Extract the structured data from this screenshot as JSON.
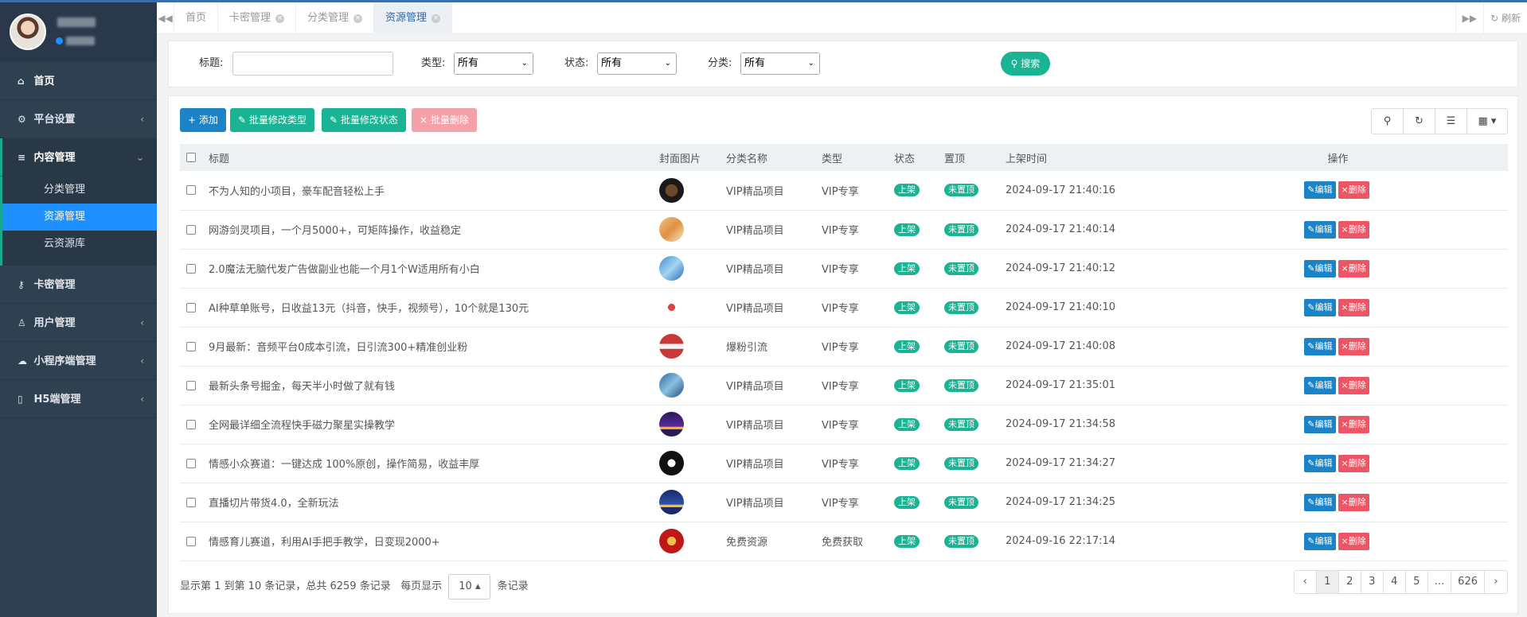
{
  "sidebar": {
    "items": [
      {
        "label": "首页",
        "icon": "home-icon"
      },
      {
        "label": "平台设置",
        "icon": "gear-icon"
      },
      {
        "label": "内容管理",
        "icon": "database-icon"
      },
      {
        "label": "卡密管理",
        "icon": "key-icon"
      },
      {
        "label": "用户管理",
        "icon": "user-icon"
      },
      {
        "label": "小程序端管理",
        "icon": "wechat-icon"
      },
      {
        "label": "H5端管理",
        "icon": "mobile-icon"
      }
    ],
    "sub_items": [
      "分类管理",
      "资源管理",
      "云资源库"
    ]
  },
  "tabs": {
    "items": [
      "首页",
      "卡密管理",
      "分类管理",
      "资源管理"
    ],
    "refresh_label": "刷新"
  },
  "search": {
    "title_label": "标题:",
    "type_label": "类型:",
    "type_value": "所有",
    "status_label": "状态:",
    "status_value": "所有",
    "category_label": "分类:",
    "category_value": "所有",
    "button_label": "搜索"
  },
  "toolbar": {
    "add_label": "添加",
    "batch_type_label": "批量修改类型",
    "batch_status_label": "批量修改状态",
    "batch_delete_label": "批量删除"
  },
  "table": {
    "headers": [
      "标题",
      "封面图片",
      "分类名称",
      "类型",
      "状态",
      "置顶",
      "上架时间",
      "操作"
    ],
    "edit_label": "编辑",
    "delete_label": "删除",
    "rows": [
      {
        "title": "不为人知的小项目，豪车配音轻松上手",
        "category": "VIP精品项目",
        "type": "VIP专享",
        "status": "上架",
        "top": "未置顶",
        "time": "2024-09-17 21:40:16"
      },
      {
        "title": "网游剑灵项目，一个月5000+，可矩阵操作，收益稳定",
        "category": "VIP精品项目",
        "type": "VIP专享",
        "status": "上架",
        "top": "未置顶",
        "time": "2024-09-17 21:40:14"
      },
      {
        "title": "2.0魔法无脑代发广告做副业也能一个月1个W适用所有小白",
        "category": "VIP精品项目",
        "type": "VIP专享",
        "status": "上架",
        "top": "未置顶",
        "time": "2024-09-17 21:40:12"
      },
      {
        "title": "AI种草单账号，日收益13元（抖音，快手，视频号），10个就是130元",
        "category": "VIP精品项目",
        "type": "VIP专享",
        "status": "上架",
        "top": "未置顶",
        "time": "2024-09-17 21:40:10"
      },
      {
        "title": "9月最新：音频平台0成本引流，日引流300+精准创业粉",
        "category": "爆粉引流",
        "type": "VIP专享",
        "status": "上架",
        "top": "未置顶",
        "time": "2024-09-17 21:40:08"
      },
      {
        "title": "最新头条号掘金，每天半小时做了就有钱",
        "category": "VIP精品项目",
        "type": "VIP专享",
        "status": "上架",
        "top": "未置顶",
        "time": "2024-09-17 21:35:01"
      },
      {
        "title": "全网最详细全流程快手磁力聚星实操教学",
        "category": "VIP精品项目",
        "type": "VIP专享",
        "status": "上架",
        "top": "未置顶",
        "time": "2024-09-17 21:34:58"
      },
      {
        "title": "情感小众赛道：一键达成 100%原创，操作简易，收益丰厚",
        "category": "VIP精品项目",
        "type": "VIP专享",
        "status": "上架",
        "top": "未置顶",
        "time": "2024-09-17 21:34:27"
      },
      {
        "title": "直播切片带货4.0，全新玩法",
        "category": "VIP精品项目",
        "type": "VIP专享",
        "status": "上架",
        "top": "未置顶",
        "time": "2024-09-17 21:34:25"
      },
      {
        "title": "情感育儿赛道，利用AI手把手教学，日变现2000+",
        "category": "免费资源",
        "type": "免费获取",
        "status": "上架",
        "top": "未置顶",
        "time": "2024-09-16 22:17:14"
      }
    ]
  },
  "footer": {
    "info_prefix": "显示第 1 到第 10 条记录，总共 6259 条记录",
    "page_size_prefix": "每页显示",
    "page_size": "10",
    "page_size_suffix": "条记录"
  },
  "pagination": [
    "‹",
    "1",
    "2",
    "3",
    "4",
    "5",
    "...",
    "626",
    "›"
  ],
  "colors": {
    "sidebar_bg": "#2f4050",
    "active_sub": "#1e90ff",
    "primary": "#1c84c6",
    "success": "#1ab394",
    "danger": "#ed5565"
  }
}
